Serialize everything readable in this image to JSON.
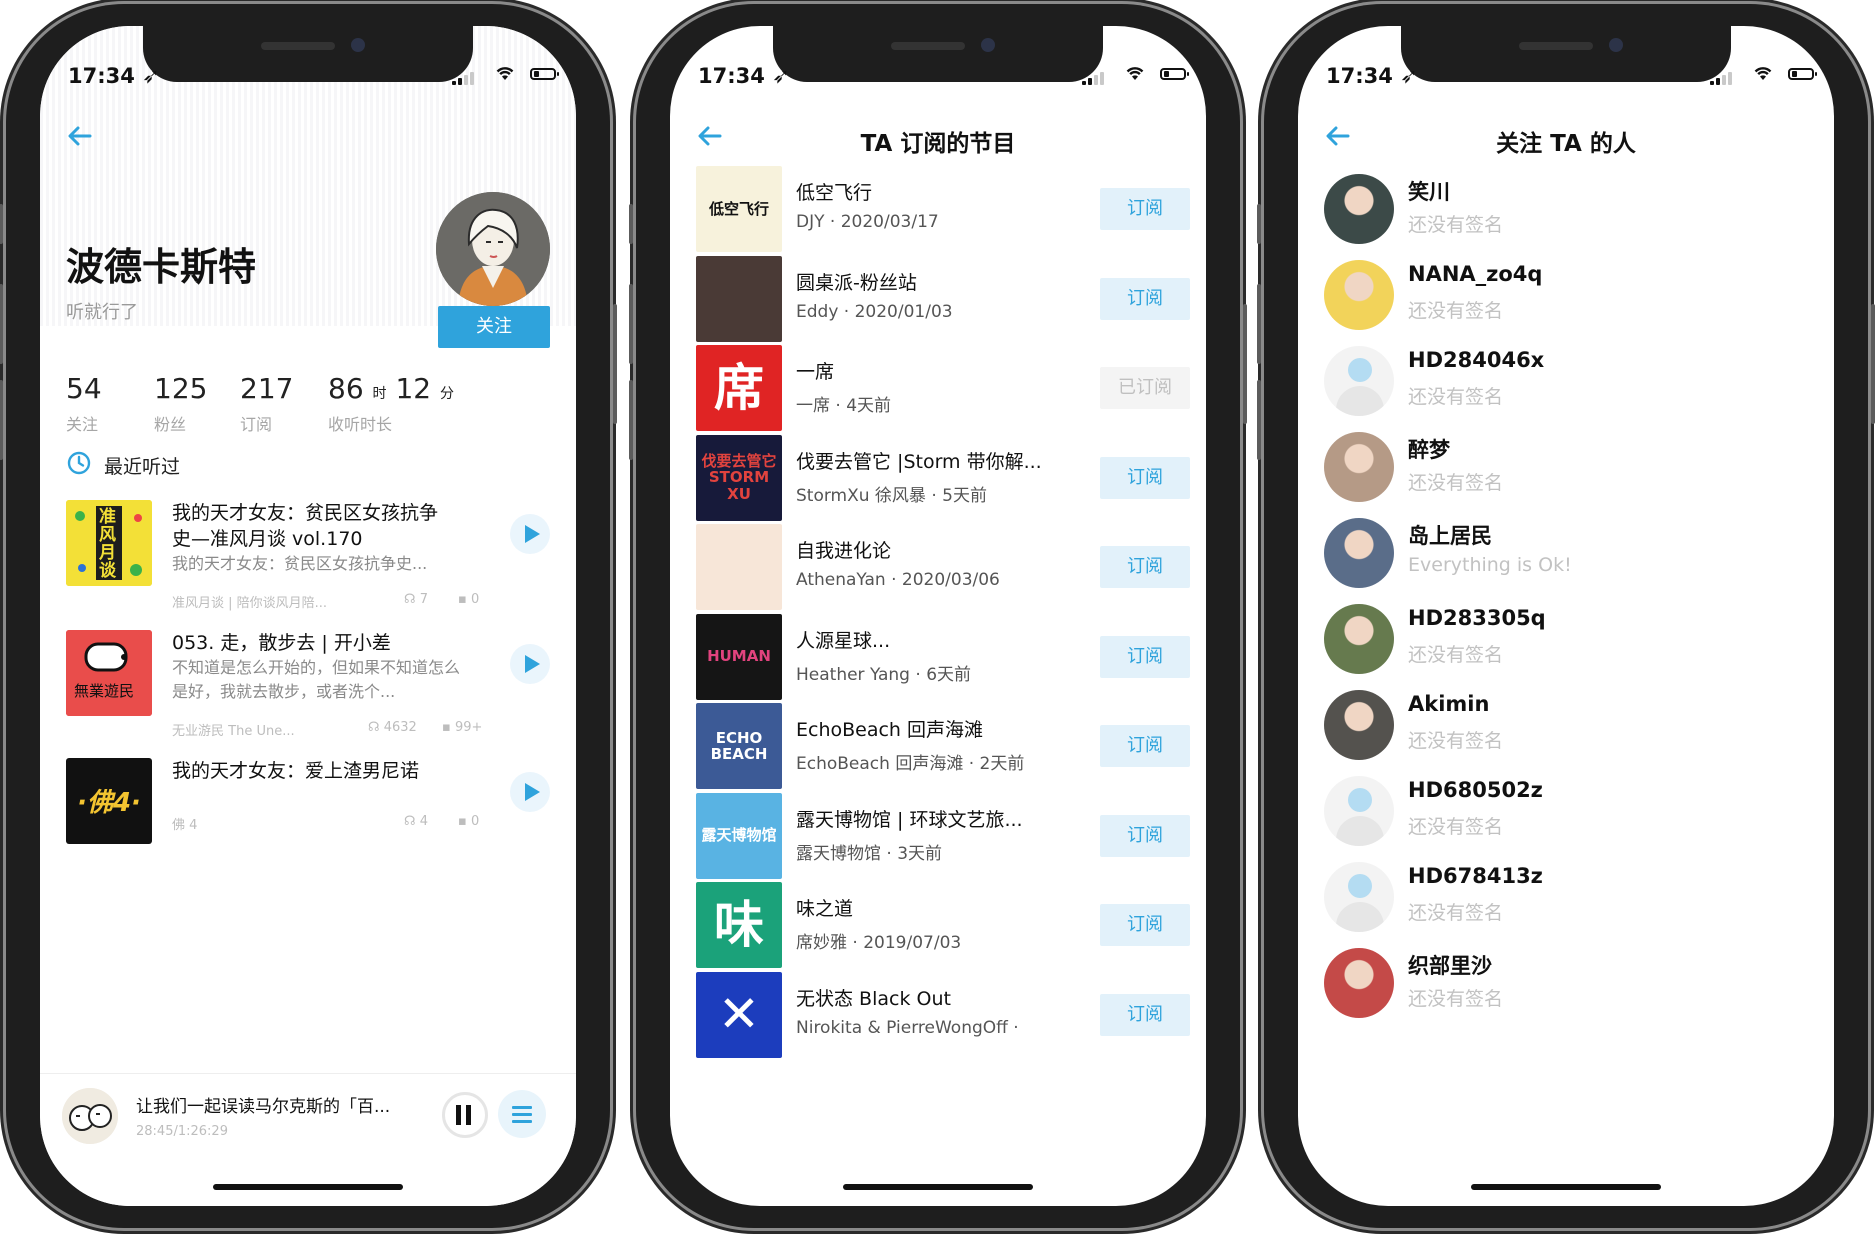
{
  "status_bar": {
    "time": "17:34 ➶"
  },
  "profile": {
    "name": "波德卡斯特",
    "signature": "听就行了",
    "follow_label": "关注",
    "stats": [
      {
        "value": "54",
        "label": "关注"
      },
      {
        "value": "125",
        "label": "粉丝"
      },
      {
        "value": "217",
        "label": "订阅"
      }
    ],
    "listen_time": {
      "hours": "86",
      "hour_unit": "时",
      "minutes": "12",
      "minute_unit": "分",
      "label": "收听时长"
    },
    "recent_title": "最近听过",
    "episodes": [
      {
        "title": "我的天才女友：贫民区女孩抗争史—准风月谈 vol.170",
        "desc": "我的天才女友：贫民区女孩抗争史...",
        "podcast": "准风月谈 | 陪你谈风月陪...",
        "plays": "7",
        "comments": "0",
        "cover_text": "准风月谈"
      },
      {
        "title": "053. 走，散步去 | 开小差",
        "desc": "不知道是怎么开始的，但如果不知道怎么是好，我就去散步，或者洗个...",
        "podcast": "无业游民 The Une...",
        "plays": "4632",
        "comments": "99+",
        "cover_text": "無業遊民"
      },
      {
        "title": "我的天才女友：爱上渣男尼诺",
        "desc": "",
        "podcast": "佛 4",
        "plays": "4",
        "comments": "0",
        "cover_text": "·佛4·"
      }
    ],
    "mini_player": {
      "title": "让我们一起误读马尔克斯的「百...",
      "time": "28:45/1:26:29"
    }
  },
  "subscriptions": {
    "title": "TA 订阅的节目",
    "items": [
      {
        "name": "低空飞行",
        "author": "DJY",
        "date": "2020/03/17",
        "button": "订阅",
        "subscribed": false,
        "cover_text": "低空飞行",
        "cover_color": "#f7f2dc",
        "cover_text_color": "#111111"
      },
      {
        "name": "圆桌派-粉丝站",
        "author": "Eddy",
        "date": "2020/01/03",
        "button": "订阅",
        "subscribed": false,
        "cover_text": "",
        "cover_color": "#4a3a36",
        "cover_text_color": "#ffffff"
      },
      {
        "name": "一席",
        "author": "一席",
        "date": "4天前",
        "button": "已订阅",
        "subscribed": true,
        "cover_text": "席",
        "cover_color": "#e02424",
        "cover_text_color": "#ffffff"
      },
      {
        "name": "伐要去管它 |Storm 带你解...",
        "author": "StormXu 徐风暴",
        "date": "5天前",
        "button": "订阅",
        "subscribed": false,
        "cover_text": "伐要去管它 STORM XU",
        "cover_color": "#171a3a",
        "cover_text_color": "#e2433e"
      },
      {
        "name": "自我进化论",
        "author": "AthenaYan",
        "date": "2020/03/06",
        "button": "订阅",
        "subscribed": false,
        "cover_text": "",
        "cover_color": "#f7e6d8",
        "cover_text_color": "#333333"
      },
      {
        "name": "人源星球...",
        "author": "Heather Yang",
        "date": "6天前",
        "button": "订阅",
        "subscribed": false,
        "cover_text": "HUMAN",
        "cover_color": "#151515",
        "cover_text_color": "#e2437e"
      },
      {
        "name": "EchoBeach 回声海滩",
        "author": "EchoBeach 回声海滩",
        "date": "2天前",
        "button": "订阅",
        "subscribed": false,
        "cover_text": "ECHO BEACH",
        "cover_color": "#3c5a96",
        "cover_text_color": "#ffffff"
      },
      {
        "name": "露天博物馆 | 环球文艺旅...",
        "author": "露天博物馆",
        "date": "3天前",
        "button": "订阅",
        "subscribed": false,
        "cover_text": "露天博物馆",
        "cover_color": "#59b3e3",
        "cover_text_color": "#ffffff"
      },
      {
        "name": "味之道",
        "author": "席妙雅",
        "date": "2019/07/03",
        "button": "订阅",
        "subscribed": false,
        "cover_text": "味",
        "cover_color": "#1ba27a",
        "cover_text_color": "#ffffff"
      },
      {
        "name": "无状态 Black Out",
        "author": "Nirokita & PierreWongOff",
        "date": "",
        "button": "订阅",
        "subscribed": false,
        "cover_text": "✕",
        "cover_color": "#1c3dbd",
        "cover_text_color": "#ffffff"
      }
    ]
  },
  "followers": {
    "title": "关注 TA 的人",
    "items": [
      {
        "name": "笑川",
        "signature": "还没有签名",
        "avatar": "photo",
        "avatar_color": "#3c4a48"
      },
      {
        "name": "NANA_zo4q",
        "signature": "还没有签名",
        "avatar": "photo",
        "avatar_color": "#f2d35a"
      },
      {
        "name": "HD284046x",
        "signature": "还没有签名",
        "avatar": "default",
        "avatar_color": "#ffffff"
      },
      {
        "name": "醉梦",
        "signature": "还没有签名",
        "avatar": "photo",
        "avatar_color": "#b59a86"
      },
      {
        "name": "岛上居民",
        "signature": "Everything is Ok!",
        "avatar": "photo",
        "avatar_color": "#5a6d89"
      },
      {
        "name": "HD283305q",
        "signature": "还没有签名",
        "avatar": "photo",
        "avatar_color": "#667a4e"
      },
      {
        "name": "Akimin",
        "signature": "还没有签名",
        "avatar": "photo",
        "avatar_color": "#54524e"
      },
      {
        "name": "HD680502z",
        "signature": "还没有签名",
        "avatar": "default",
        "avatar_color": "#ffffff"
      },
      {
        "name": "HD678413z",
        "signature": "还没有签名",
        "avatar": "default",
        "avatar_color": "#ffffff"
      },
      {
        "name": "织部里沙",
        "signature": "还没有签名",
        "avatar": "photo",
        "avatar_color": "#c44a48"
      }
    ]
  },
  "theme": {
    "accent": "#2fa3dc",
    "accent_light": "#e2f1fa",
    "text": "#111111",
    "muted": "#9a9a9a"
  },
  "icons": [
    "back-arrow-icon",
    "clock-icon",
    "play-icon",
    "pause-icon",
    "playlist-icon",
    "signal-icon",
    "wifi-icon",
    "battery-icon",
    "headphones-icon",
    "comment-icon"
  ]
}
